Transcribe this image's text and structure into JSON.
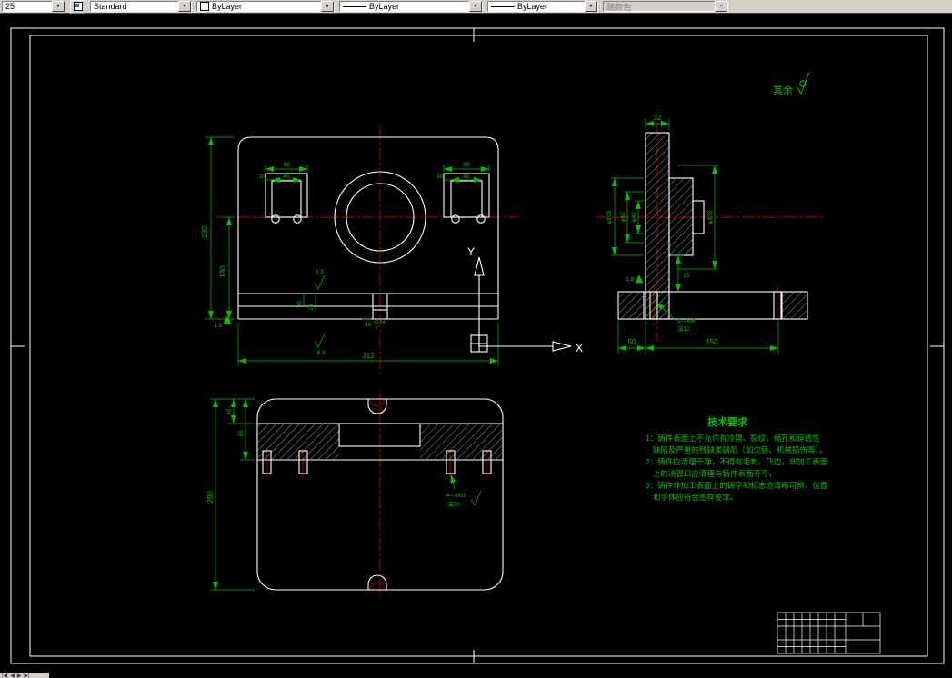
{
  "toolbar": {
    "layer": "25",
    "text_style": "Standard",
    "color": "ByLayer",
    "linetype": "ByLayer",
    "lineweight": "ByLayer",
    "plot_style": "随颜色"
  },
  "icons": {
    "arrow": "▼",
    "tab_first": "|◀",
    "tab_prev": "◀",
    "tab_next": "▶",
    "tab_last": "▶|"
  },
  "colors": {
    "geometry": "#ffffff",
    "dimension": "#00c000",
    "centerline": "#c00000",
    "toolbar_bg": "#d4d0c8"
  },
  "notes": {
    "rest": "其余"
  },
  "ucs": {
    "x": "X",
    "y": "Y"
  },
  "tech": {
    "title": "技术要求",
    "lines": [
      "1：铸件表面上不允许有冷隔、裂纹、缩孔和穿透性",
      "缺陷及严重的残缺类缺陷（如欠铸、机械损伤等），",
      "2：铸件应清理干净，不得有毛刺、飞边，非加工表面",
      "上的浇冒口应清理与铸件表面齐平，",
      "3：铸件非加工表面上的铸字和标志应清晰可辨，位置",
      "和字体应符合图样要求。"
    ]
  },
  "front": {
    "h230": "230",
    "h130": "130",
    "w312": "312",
    "lp68": "68",
    "lp10": "10",
    "lp45": "45",
    "rp68": "68",
    "rp10": "10",
    "rp45": "45",
    "ra1": "6.3",
    "ra2": "6.3",
    "ra3": "1.6",
    "s50": "50",
    "s20": "20",
    "s16": "16",
    "s16t": "+0.04",
    "s16b": "0"
  },
  "side": {
    "w32": "32",
    "d100": "φ100",
    "d62": "φ62",
    "d40": "φ40",
    "d130": "φ130",
    "h25": "25",
    "ra": "1.6",
    "thread": "2—M6",
    "depth": "深12",
    "b50": "50",
    "b150": "150"
  },
  "bottom": {
    "h280": "280",
    "h40": "40",
    "h65": "65",
    "thread": "4—M10",
    "depth": "深20"
  }
}
